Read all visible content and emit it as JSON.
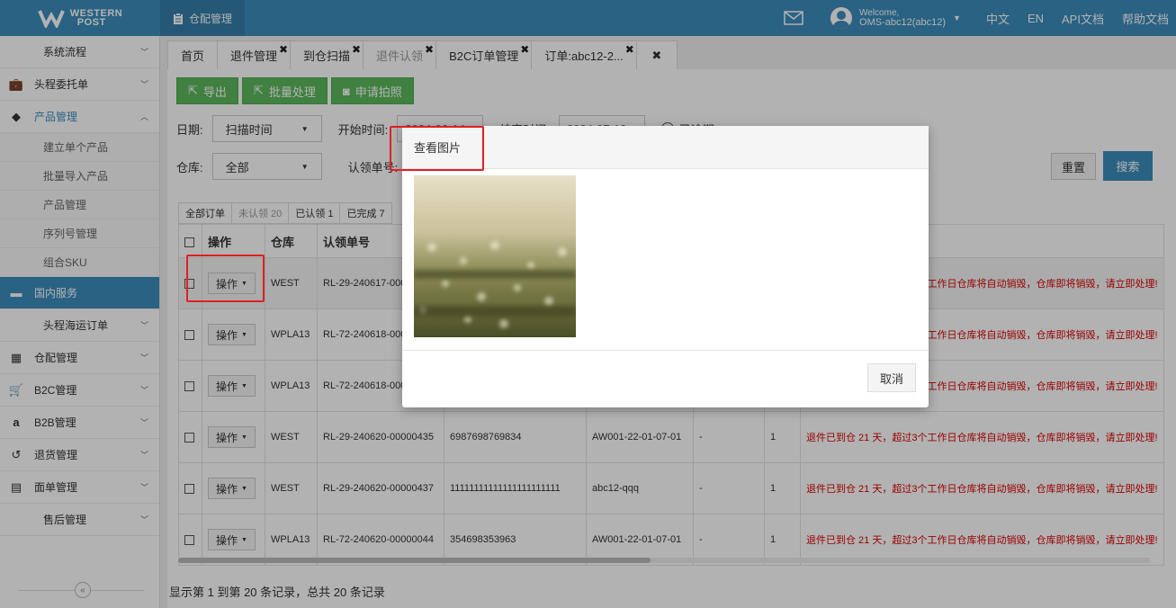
{
  "brand": {
    "line1": "WESTERN",
    "line2": "POST"
  },
  "header": {
    "module_tab": "仓配管理",
    "welcome": "Welcome,",
    "user": "OMS-abc12(abc12)",
    "links": [
      "中文",
      "EN",
      "API文档",
      "帮助文档"
    ]
  },
  "sidebar": {
    "items": [
      {
        "label": "系统流程"
      },
      {
        "label": "头程委托单"
      },
      {
        "label": "产品管理"
      },
      {
        "label": "建立单个产品"
      },
      {
        "label": "批量导入产品"
      },
      {
        "label": "产品管理"
      },
      {
        "label": "序列号管理"
      },
      {
        "label": "组合SKU"
      },
      {
        "label": "国内服务"
      },
      {
        "label": "头程海运订单"
      },
      {
        "label": "仓配管理"
      },
      {
        "label": "B2C管理"
      },
      {
        "label": "B2B管理"
      },
      {
        "label": "退货管理"
      },
      {
        "label": "面单管理"
      },
      {
        "label": "售后管理"
      }
    ],
    "collapse": "«"
  },
  "tabs": [
    {
      "label": "首页"
    },
    {
      "label": "退件管理"
    },
    {
      "label": "到仓扫描"
    },
    {
      "label": "退件认领"
    },
    {
      "label": "B2C订单管理"
    },
    {
      "label": "订单:abc12-2..."
    }
  ],
  "toolbar": {
    "export": "导出",
    "batch": "批量处理",
    "photo": "申请拍照"
  },
  "filters": {
    "date_label": "日期:",
    "date_type": "扫描时间",
    "start_label": "开始时间:",
    "start_value": "2024-06-14",
    "end_label": "结束时间:",
    "end_value": "2024-07-13",
    "overdue_label": "已逾期",
    "warehouse_label": "仓库:",
    "warehouse_value": "全部",
    "claim_label": "认领单号:",
    "reset": "重置",
    "search": "搜索"
  },
  "subtabs": [
    "全部订单",
    "未认领 20",
    "已认领 1",
    "已完成 7"
  ],
  "table": {
    "headers": [
      "操作",
      "仓库",
      "认领单号",
      "",
      "",
      "",
      "",
      ""
    ],
    "op_label": "操作",
    "notice": "退件已到仓 21 天，超过3个工作日仓库将自动销毁，仓库即将销毁，请立即处理!",
    "rows": [
      {
        "wh": "WEST",
        "claim": "RL-29-240617-00000429",
        "track": "",
        "sku": "",
        "col5": "",
        "qty": ""
      },
      {
        "wh": "WPLA13",
        "claim": "RL-72-240618-00000041",
        "track": "",
        "sku": "",
        "col5": "",
        "qty": ""
      },
      {
        "wh": "WPLA13",
        "claim": "RL-72-240618-00000042",
        "track": "",
        "sku": "",
        "col5": "",
        "qty": ""
      },
      {
        "wh": "WEST",
        "claim": "RL-29-240620-00000435",
        "track": "6987698769834",
        "sku": "AW001-22-01-07-01",
        "col5": "-",
        "qty": "1"
      },
      {
        "wh": "WEST",
        "claim": "RL-29-240620-00000437",
        "track": "11111111111111111111111",
        "sku": "abc12-qqq",
        "col5": "-",
        "qty": "1"
      },
      {
        "wh": "WPLA13",
        "claim": "RL-72-240620-00000044",
        "track": "354698353963",
        "sku": "AW001-22-01-07-01",
        "col5": "-",
        "qty": "1"
      }
    ]
  },
  "footer": {
    "summary": "显示第 1 到第 20 条记录，总共 20 条记录"
  },
  "modal": {
    "title": "查看图片",
    "cancel": "取消"
  },
  "colors": {
    "primary": "#3c8dbc",
    "success": "#5cb85c",
    "danger": "#dd0000",
    "highlight": "#e02020"
  }
}
